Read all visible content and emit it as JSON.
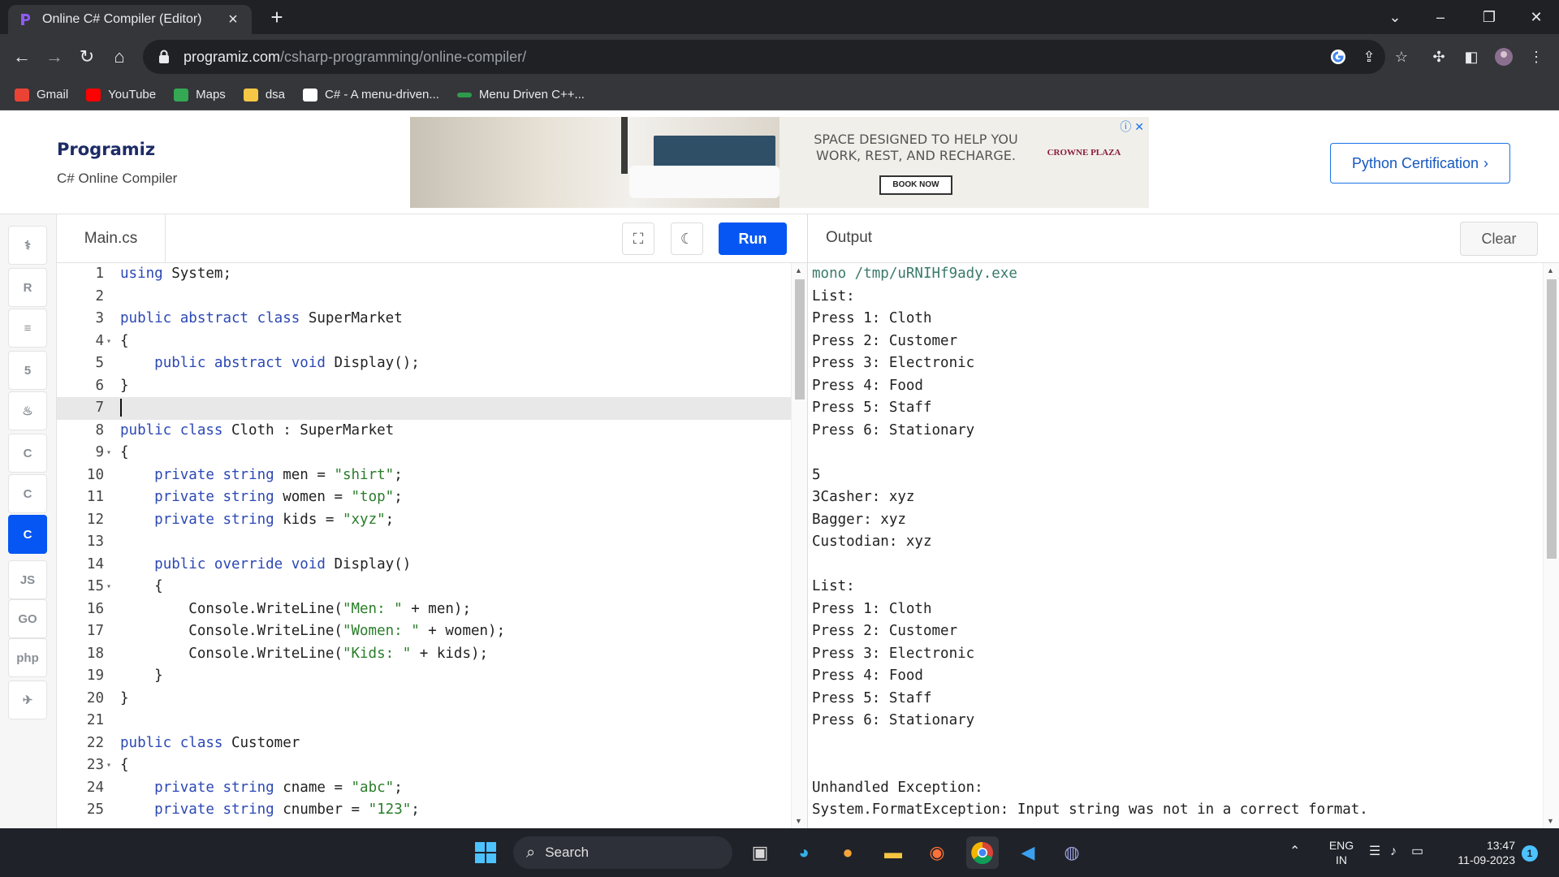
{
  "browser": {
    "tab_title": "Online C# Compiler (Editor)",
    "url_host": "programiz.com",
    "url_path": "/csharp-programming/online-compiler/",
    "bookmarks": [
      {
        "label": "Gmail",
        "icon": "gmail-icon",
        "color": "#ea4335"
      },
      {
        "label": "YouTube",
        "icon": "youtube-icon",
        "color": "#ff0000"
      },
      {
        "label": "Maps",
        "icon": "maps-icon",
        "color": "#34a853"
      },
      {
        "label": "dsa",
        "icon": "folder-icon",
        "color": "#f6c744"
      },
      {
        "label": "C# - A menu-driven...",
        "icon": "w3r-icon",
        "color": "#ffffff"
      },
      {
        "label": "Menu Driven C++...",
        "icon": "link-icon",
        "color": "#2e9b4c"
      }
    ]
  },
  "header": {
    "logo": "Programiz",
    "subtitle": "C# Online Compiler",
    "ad_text": "SPACE DESIGNED TO HELP YOU WORK, REST, AND RECHARGE.",
    "ad_button": "BOOK NOW",
    "ad_brand": "CROWNE PLAZA",
    "cta": "Python Certification"
  },
  "languages": [
    {
      "name": "python",
      "glyph": "⚕",
      "active": false
    },
    {
      "name": "r",
      "glyph": "R",
      "active": false
    },
    {
      "name": "sql",
      "glyph": "≡",
      "active": false
    },
    {
      "name": "html",
      "glyph": "5",
      "active": false
    },
    {
      "name": "java",
      "glyph": "♨",
      "active": false
    },
    {
      "name": "c",
      "glyph": "C",
      "active": false
    },
    {
      "name": "cpp",
      "glyph": "C",
      "active": false
    },
    {
      "name": "csharp",
      "glyph": "C",
      "active": true
    },
    {
      "name": "js",
      "glyph": "JS",
      "active": false
    },
    {
      "name": "go",
      "glyph": "GO",
      "active": false
    },
    {
      "name": "php",
      "glyph": "php",
      "active": false
    },
    {
      "name": "swift",
      "glyph": "✈",
      "active": false
    }
  ],
  "editor": {
    "filename": "Main.cs",
    "run_label": "Run",
    "current_line": 7,
    "lines": [
      {
        "n": "1",
        "fold": false,
        "tokens": [
          {
            "t": "kw",
            "v": "using"
          },
          {
            "t": "",
            "v": " System;"
          }
        ]
      },
      {
        "n": "2",
        "fold": false,
        "tokens": []
      },
      {
        "n": "3",
        "fold": false,
        "tokens": [
          {
            "t": "kw",
            "v": "public"
          },
          {
            "t": "",
            "v": " "
          },
          {
            "t": "kw",
            "v": "abstract"
          },
          {
            "t": "",
            "v": " "
          },
          {
            "t": "kw",
            "v": "class"
          },
          {
            "t": "",
            "v": " SuperMarket"
          }
        ]
      },
      {
        "n": "4",
        "fold": true,
        "tokens": [
          {
            "t": "",
            "v": "{"
          }
        ]
      },
      {
        "n": "5",
        "fold": false,
        "tokens": [
          {
            "t": "",
            "v": "    "
          },
          {
            "t": "kw",
            "v": "public"
          },
          {
            "t": "",
            "v": " "
          },
          {
            "t": "kw",
            "v": "abstract"
          },
          {
            "t": "",
            "v": " "
          },
          {
            "t": "kw",
            "v": "void"
          },
          {
            "t": "",
            "v": " Display();"
          }
        ]
      },
      {
        "n": "6",
        "fold": false,
        "tokens": [
          {
            "t": "",
            "v": "}"
          }
        ]
      },
      {
        "n": "7",
        "fold": false,
        "tokens": []
      },
      {
        "n": "8",
        "fold": false,
        "tokens": [
          {
            "t": "kw",
            "v": "public"
          },
          {
            "t": "",
            "v": " "
          },
          {
            "t": "kw",
            "v": "class"
          },
          {
            "t": "",
            "v": " Cloth : SuperMarket"
          }
        ]
      },
      {
        "n": "9",
        "fold": true,
        "tokens": [
          {
            "t": "",
            "v": "{"
          }
        ]
      },
      {
        "n": "10",
        "fold": false,
        "tokens": [
          {
            "t": "",
            "v": "    "
          },
          {
            "t": "kw",
            "v": "private"
          },
          {
            "t": "",
            "v": " "
          },
          {
            "t": "kw",
            "v": "string"
          },
          {
            "t": "",
            "v": " men = "
          },
          {
            "t": "str",
            "v": "\"shirt\""
          },
          {
            "t": "",
            "v": ";"
          }
        ]
      },
      {
        "n": "11",
        "fold": false,
        "tokens": [
          {
            "t": "",
            "v": "    "
          },
          {
            "t": "kw",
            "v": "private"
          },
          {
            "t": "",
            "v": " "
          },
          {
            "t": "kw",
            "v": "string"
          },
          {
            "t": "",
            "v": " women = "
          },
          {
            "t": "str",
            "v": "\"top\""
          },
          {
            "t": "",
            "v": ";"
          }
        ]
      },
      {
        "n": "12",
        "fold": false,
        "tokens": [
          {
            "t": "",
            "v": "    "
          },
          {
            "t": "kw",
            "v": "private"
          },
          {
            "t": "",
            "v": " "
          },
          {
            "t": "kw",
            "v": "string"
          },
          {
            "t": "",
            "v": " kids = "
          },
          {
            "t": "str",
            "v": "\"xyz\""
          },
          {
            "t": "",
            "v": ";"
          }
        ]
      },
      {
        "n": "13",
        "fold": false,
        "tokens": []
      },
      {
        "n": "14",
        "fold": false,
        "tokens": [
          {
            "t": "",
            "v": "    "
          },
          {
            "t": "kw",
            "v": "public"
          },
          {
            "t": "",
            "v": " "
          },
          {
            "t": "kw",
            "v": "override"
          },
          {
            "t": "",
            "v": " "
          },
          {
            "t": "kw",
            "v": "void"
          },
          {
            "t": "",
            "v": " Display()"
          }
        ]
      },
      {
        "n": "15",
        "fold": true,
        "tokens": [
          {
            "t": "",
            "v": "    {"
          }
        ]
      },
      {
        "n": "16",
        "fold": false,
        "tokens": [
          {
            "t": "",
            "v": "        Console.WriteLine("
          },
          {
            "t": "str",
            "v": "\"Men: \""
          },
          {
            "t": "",
            "v": " + men);"
          }
        ]
      },
      {
        "n": "17",
        "fold": false,
        "tokens": [
          {
            "t": "",
            "v": "        Console.WriteLine("
          },
          {
            "t": "str",
            "v": "\"Women: \""
          },
          {
            "t": "",
            "v": " + women);"
          }
        ]
      },
      {
        "n": "18",
        "fold": false,
        "tokens": [
          {
            "t": "",
            "v": "        Console.WriteLine("
          },
          {
            "t": "str",
            "v": "\"Kids: \""
          },
          {
            "t": "",
            "v": " + kids);"
          }
        ]
      },
      {
        "n": "19",
        "fold": false,
        "tokens": [
          {
            "t": "",
            "v": "    }"
          }
        ]
      },
      {
        "n": "20",
        "fold": false,
        "tokens": [
          {
            "t": "",
            "v": "}"
          }
        ]
      },
      {
        "n": "21",
        "fold": false,
        "tokens": []
      },
      {
        "n": "22",
        "fold": false,
        "tokens": [
          {
            "t": "kw",
            "v": "public"
          },
          {
            "t": "",
            "v": " "
          },
          {
            "t": "kw",
            "v": "class"
          },
          {
            "t": "",
            "v": " Customer"
          }
        ]
      },
      {
        "n": "23",
        "fold": true,
        "tokens": [
          {
            "t": "",
            "v": "{"
          }
        ]
      },
      {
        "n": "24",
        "fold": false,
        "tokens": [
          {
            "t": "",
            "v": "    "
          },
          {
            "t": "kw",
            "v": "private"
          },
          {
            "t": "",
            "v": " "
          },
          {
            "t": "kw",
            "v": "string"
          },
          {
            "t": "",
            "v": " cname = "
          },
          {
            "t": "str",
            "v": "\"abc\""
          },
          {
            "t": "",
            "v": ";"
          }
        ]
      },
      {
        "n": "25",
        "fold": false,
        "tokens": [
          {
            "t": "",
            "v": "    "
          },
          {
            "t": "kw",
            "v": "private"
          },
          {
            "t": "",
            "v": " "
          },
          {
            "t": "kw",
            "v": "string"
          },
          {
            "t": "",
            "v": " cnumber = "
          },
          {
            "t": "str",
            "v": "\"123\""
          },
          {
            "t": "",
            "v": ";"
          }
        ]
      }
    ]
  },
  "output": {
    "title": "Output",
    "clear_label": "Clear",
    "lines": [
      "mono /tmp/uRNIHf9ady.exe",
      "List:",
      "Press 1: Cloth",
      "Press 2: Customer",
      "Press 3: Electronic",
      "Press 4: Food",
      "Press 5: Staff",
      "Press 6: Stationary",
      "",
      "5",
      "3Casher: xyz",
      "Bagger: xyz",
      "Custodian: xyz",
      "",
      "List:",
      "Press 1: Cloth",
      "Press 2: Customer",
      "Press 3: Electronic",
      "Press 4: Food",
      "Press 5: Staff",
      "Press 6: Stationary",
      "",
      "",
      "Unhandled Exception:",
      "System.FormatException: Input string was not in a correct format."
    ]
  },
  "taskbar": {
    "search_label": "Search",
    "lang_top": "ENG",
    "lang_bottom": "IN",
    "time": "13:47",
    "date": "11-09-2023",
    "notifications": "1"
  }
}
